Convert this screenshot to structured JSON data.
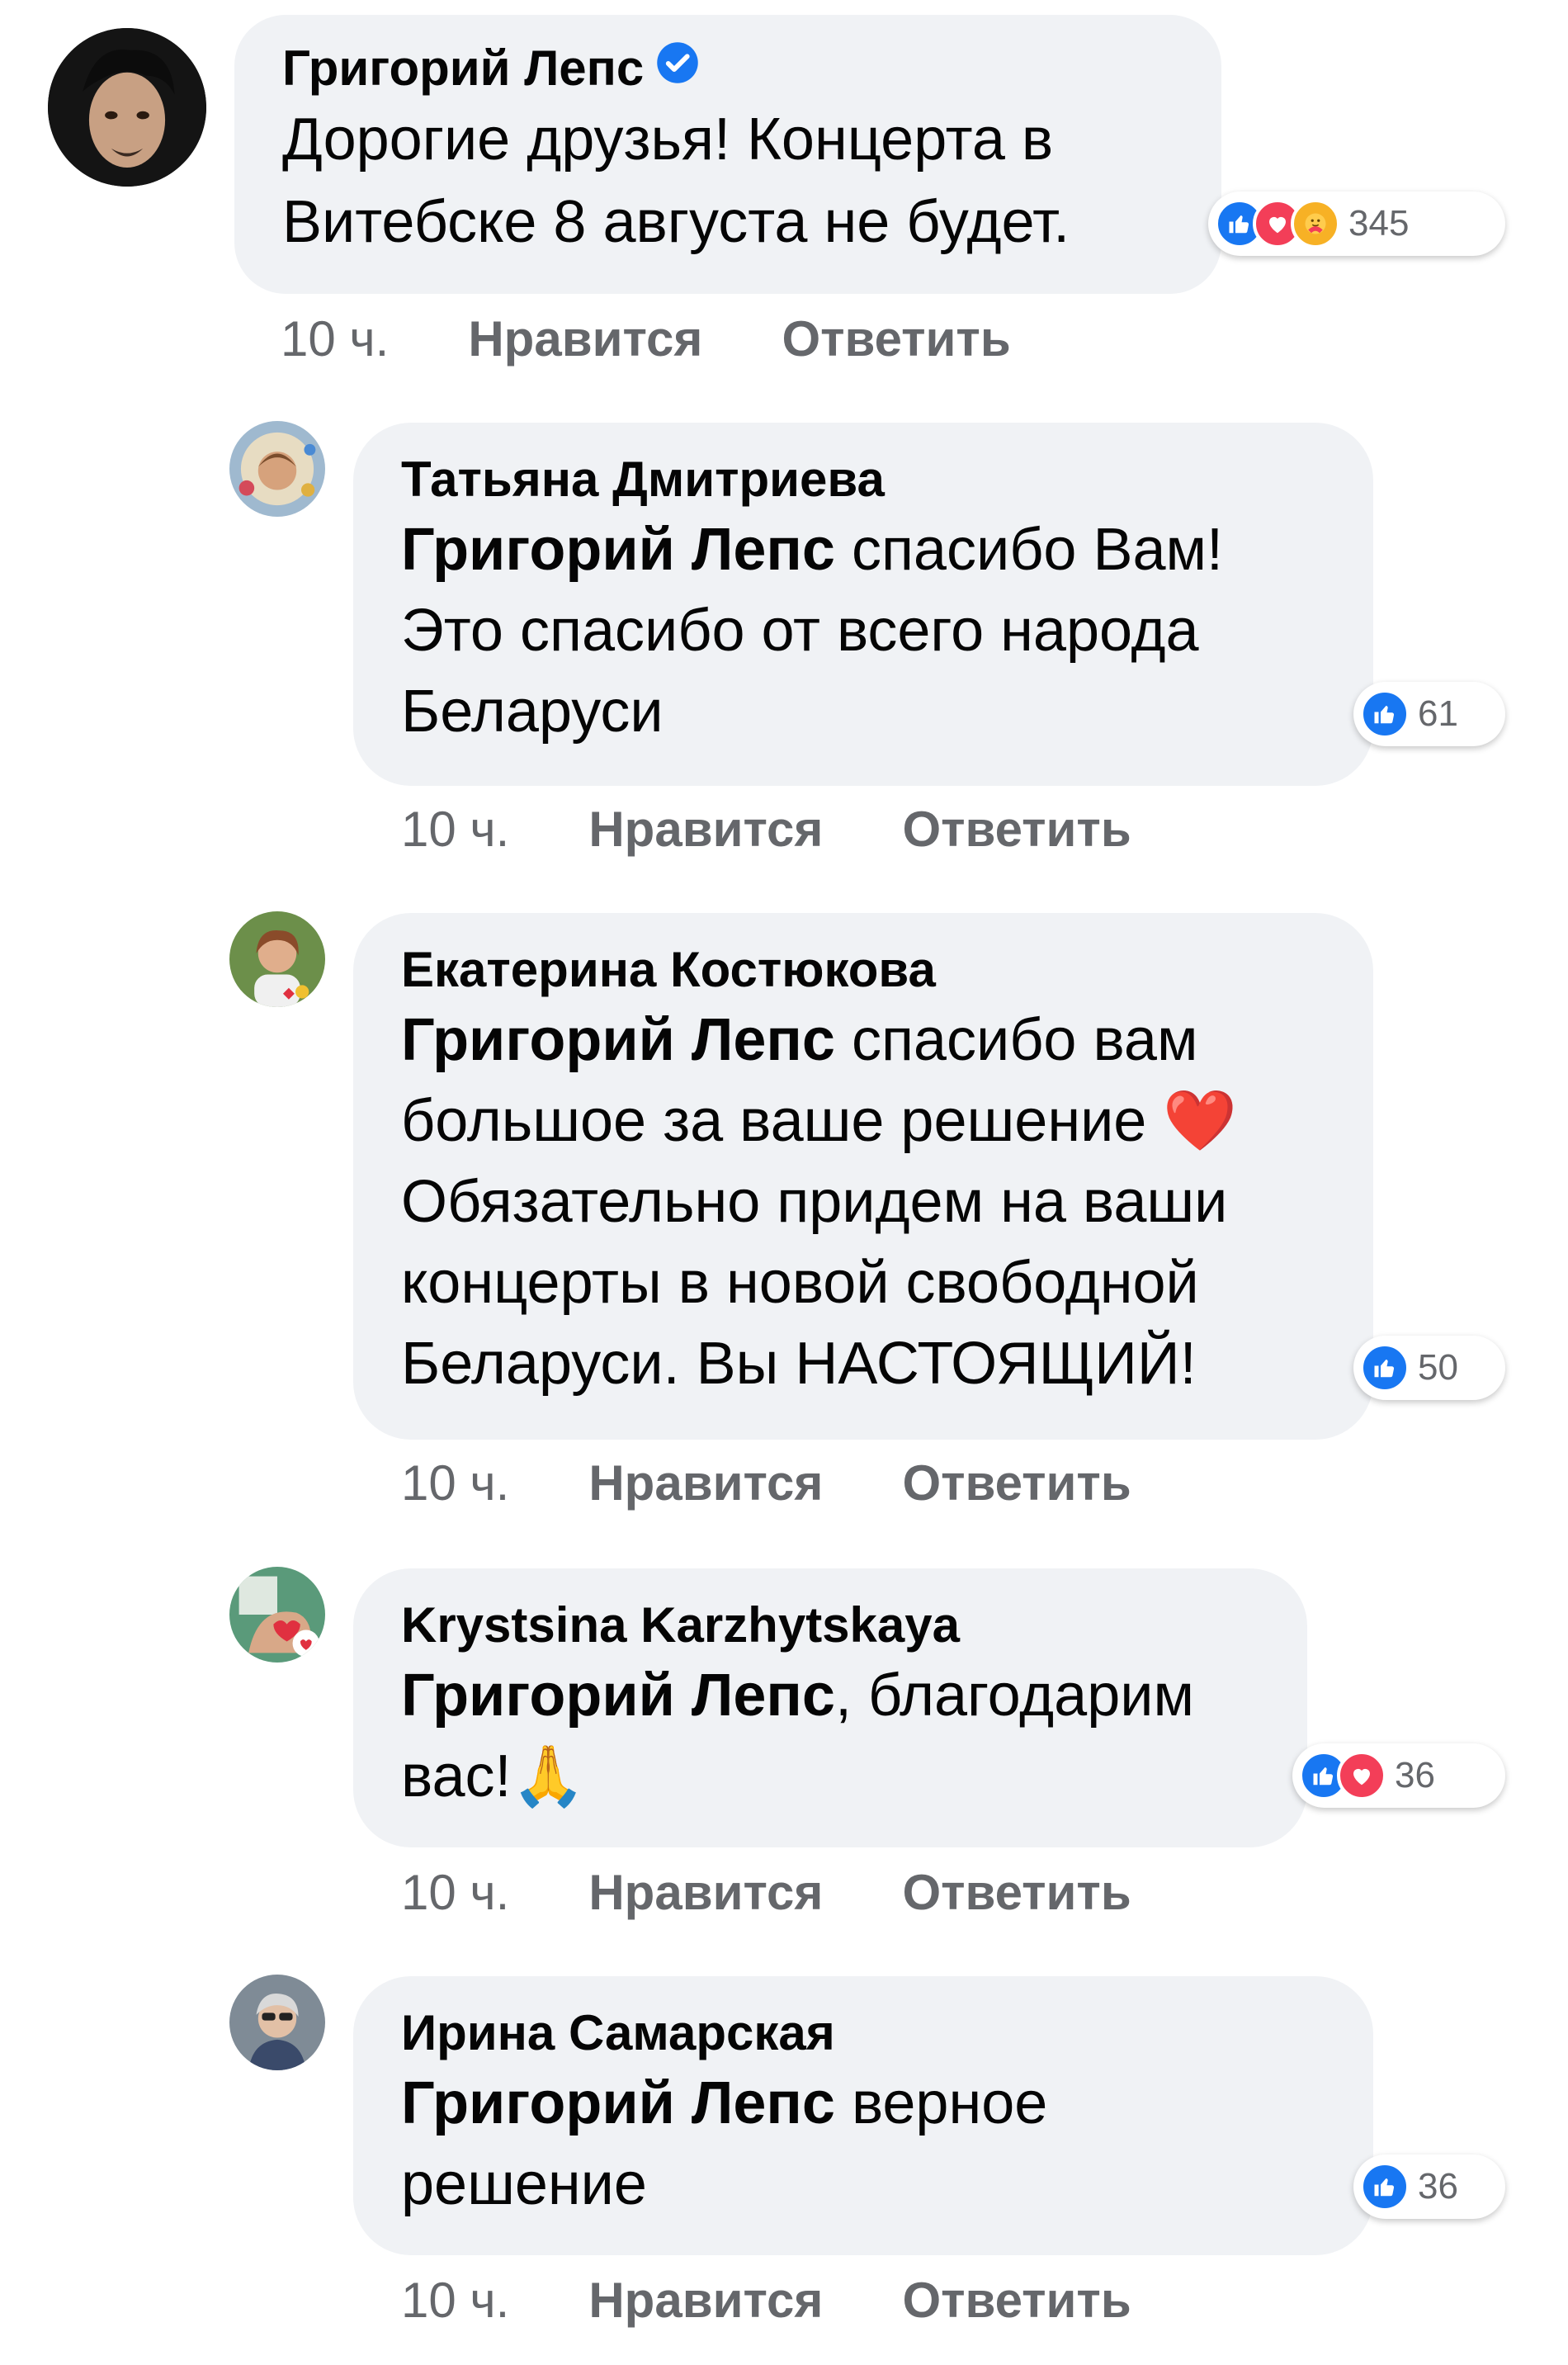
{
  "comments": [
    {
      "author": "Григорий Лепс",
      "verified": true,
      "text_lines": [
        "Дорогие друзья! Концерта в",
        "Витебске 8 августа не будет."
      ],
      "reaction_count": "345",
      "time": "10 ч.",
      "like_label": "Нравится",
      "reply_label": "Ответить"
    },
    {
      "author": "Татьяна Дмитриева",
      "mention": "Григорий Лепс",
      "text_first": " спасибо Вам!",
      "text_rest": [
        "Это спасибо от всего народа",
        "Беларуси"
      ],
      "reaction_count": "61",
      "time": "10 ч.",
      "like_label": "Нравится",
      "reply_label": "Ответить"
    },
    {
      "author": "Екатерина Костюкова",
      "mention": "Григорий Лепс",
      "text_first": " спасибо вам",
      "text_rest": [
        "большое за ваше решение ❤️",
        "Обязательно придем на ваши",
        "концерты в новой свободной",
        "Беларуси. Вы НАСТОЯЩИЙ!"
      ],
      "reaction_count": "50",
      "time": "10 ч.",
      "like_label": "Нравится",
      "reply_label": "Ответить"
    },
    {
      "author": "Krystsina Karzhytskaya",
      "mention": "Григорий Лепс",
      "text_first": ", благодарим",
      "text_rest": [
        "вас!🙏"
      ],
      "reaction_count": "36",
      "time": "10 ч.",
      "like_label": "Нравится",
      "reply_label": "Ответить"
    },
    {
      "author": "Ирина Самарская",
      "mention": "Григорий Лепс",
      "text_first": " верное",
      "text_rest": [
        "решение"
      ],
      "reaction_count": "36",
      "time": "10 ч.",
      "like_label": "Нравится",
      "reply_label": "Ответить"
    }
  ],
  "icons": {
    "verified": "verified-badge-icon",
    "like": "like-reaction-icon",
    "love": "love-reaction-icon",
    "care": "care-reaction-icon"
  },
  "colors": {
    "bubble": "#f0f2f5",
    "secondary_text": "#65676b",
    "like_blue": "#1877f2",
    "love_red": "#f33e58",
    "care_yellow": "#f7b125"
  }
}
